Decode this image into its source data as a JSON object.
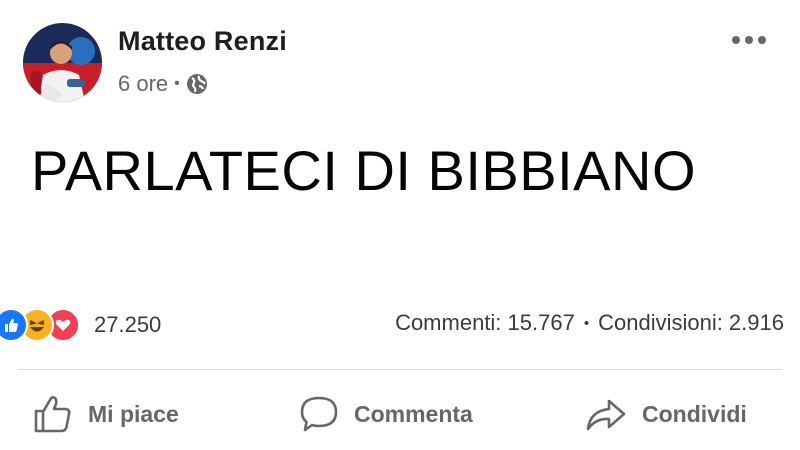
{
  "header": {
    "author": "Matteo Renzi",
    "time": "6 ore",
    "privacy_icon": "globe-icon",
    "more_icon": "more-options-icon"
  },
  "post": {
    "text": "PARLATECI DI BIBBIANO"
  },
  "stats": {
    "reactions": [
      "like",
      "haha",
      "love"
    ],
    "reaction_count": "27.250",
    "comments": "Commenti: 15.767",
    "shares": "Condivisioni: 2.916"
  },
  "actions": {
    "like_label": "Mi piace",
    "comment_label": "Commenta",
    "share_label": "Condividi"
  },
  "colors": {
    "like_blue": "#1877f2",
    "haha_yellow": "#f7b125",
    "love_red": "#f33e58",
    "secondary_text": "#65676b"
  }
}
